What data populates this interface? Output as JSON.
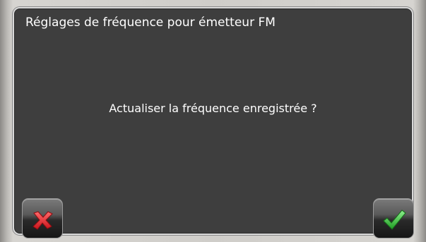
{
  "dialog": {
    "title": "Réglages de fréquence pour émetteur FM",
    "message": "Actualiser la fréquence enregistrée ?"
  },
  "buttons": {
    "cancel": {
      "icon": "red-x-icon",
      "color": "#e8242b"
    },
    "confirm": {
      "icon": "green-checkmark-icon",
      "color": "#2fb52f"
    }
  }
}
